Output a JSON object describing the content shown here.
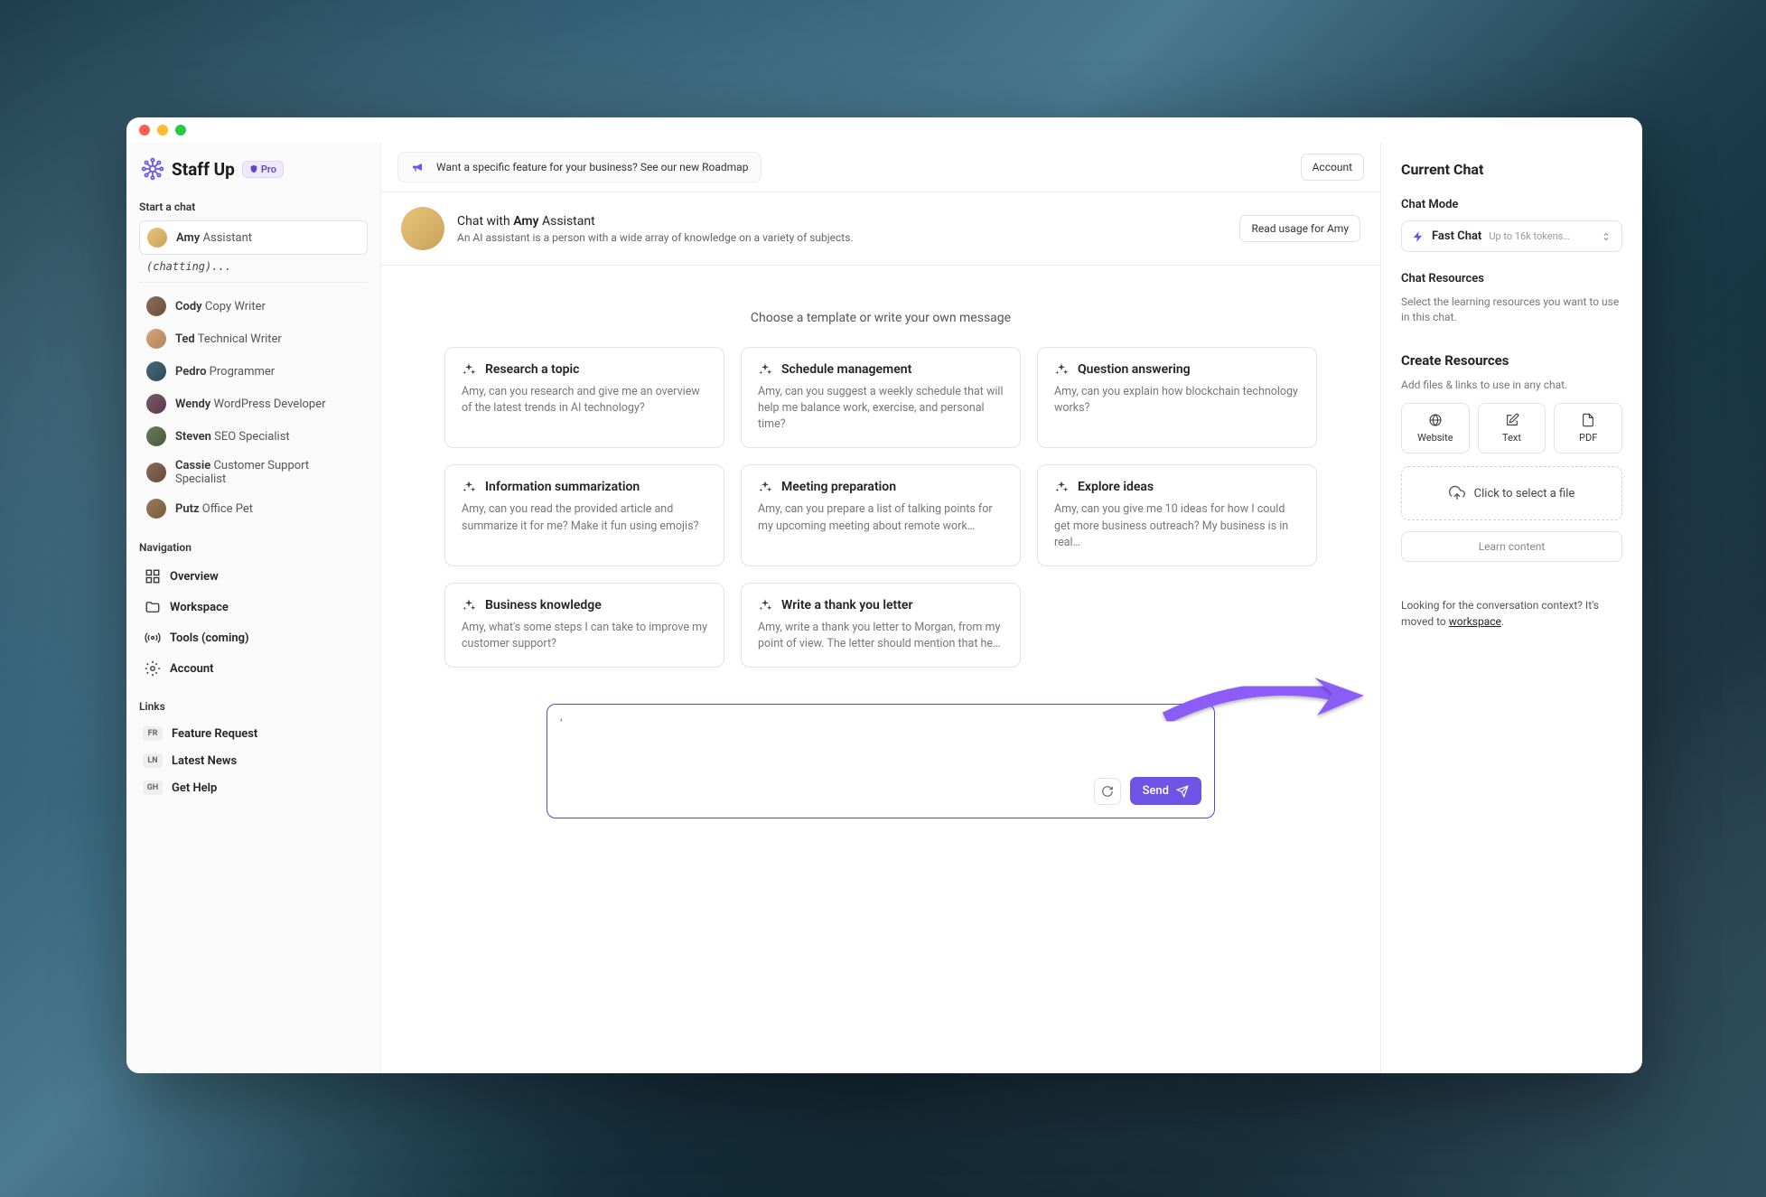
{
  "brand": {
    "name": "Staff Up",
    "badge": "Pro"
  },
  "sidebar": {
    "start_label": "Start a chat",
    "chatting_status": "(chatting)...",
    "staff": [
      {
        "name": "Amy",
        "role": "Assistant"
      },
      {
        "name": "Cody",
        "role": "Copy Writer"
      },
      {
        "name": "Ted",
        "role": "Technical Writer"
      },
      {
        "name": "Pedro",
        "role": "Programmer"
      },
      {
        "name": "Wendy",
        "role": "WordPress Developer"
      },
      {
        "name": "Steven",
        "role": "SEO Specialist"
      },
      {
        "name": "Cassie",
        "role": "Customer Support Specialist"
      },
      {
        "name": "Putz",
        "role": "Office Pet"
      }
    ],
    "nav_label": "Navigation",
    "nav": [
      "Overview",
      "Workspace",
      "Tools (coming)",
      "Account"
    ],
    "links_label": "Links",
    "links": [
      {
        "badge": "FR",
        "label": "Feature Request"
      },
      {
        "badge": "LN",
        "label": "Latest News"
      },
      {
        "badge": "GH",
        "label": "Get Help"
      }
    ]
  },
  "banner": {
    "text": "Want a specific feature for your business? See our new Roadmap",
    "account": "Account"
  },
  "chat_header": {
    "prefix": "Chat with ",
    "name": "Amy",
    "suffix": " Assistant",
    "sub": "An AI assistant is a person with a wide array of knowledge on a variety of subjects.",
    "usage_btn": "Read usage for Amy"
  },
  "prompt_hint": "Choose a template or write your own message",
  "templates": [
    {
      "title": "Research a topic",
      "body": "Amy, can you research and give me an overview of the latest trends in AI technology?"
    },
    {
      "title": "Schedule management",
      "body": "Amy, can you suggest a weekly schedule that will help me balance work, exercise, and personal time?"
    },
    {
      "title": "Question answering",
      "body": "Amy, can you explain how blockchain technology works?"
    },
    {
      "title": "Information summarization",
      "body": "Amy, can you read the provided article and summarize it for me? Make it fun using emojis?"
    },
    {
      "title": "Meeting preparation",
      "body": "Amy, can you prepare a list of talking points for my upcoming meeting about remote work…"
    },
    {
      "title": "Explore ideas",
      "body": "Amy, can you give me 10 ideas for how I could get more business outreach? My business is in real…"
    },
    {
      "title": "Business knowledge",
      "body": "Amy, what's some steps I can take to improve my customer support?"
    },
    {
      "title": "Write a thank you letter",
      "body": "Amy, write a thank you letter to Morgan, from my point of view. The letter should mention that he…"
    }
  ],
  "composer": {
    "value": "'",
    "send": "Send"
  },
  "rightbar": {
    "title": "Current Chat",
    "mode_label": "Chat Mode",
    "mode_name": "Fast Chat",
    "mode_desc": "Up to 16k tokens…",
    "resources_label": "Chat Resources",
    "resources_desc": "Select the learning resources you want to use in this chat.",
    "create_label": "Create Resources",
    "create_desc": "Add files & links to use in any chat.",
    "res_btns": [
      "Website",
      "Text",
      "PDF"
    ],
    "dropzone": "Click to select a file",
    "learn": "Learn content",
    "context_note_1": "Looking for the conversation context? It's moved to ",
    "context_note_link": "workspace",
    "context_note_2": "."
  }
}
